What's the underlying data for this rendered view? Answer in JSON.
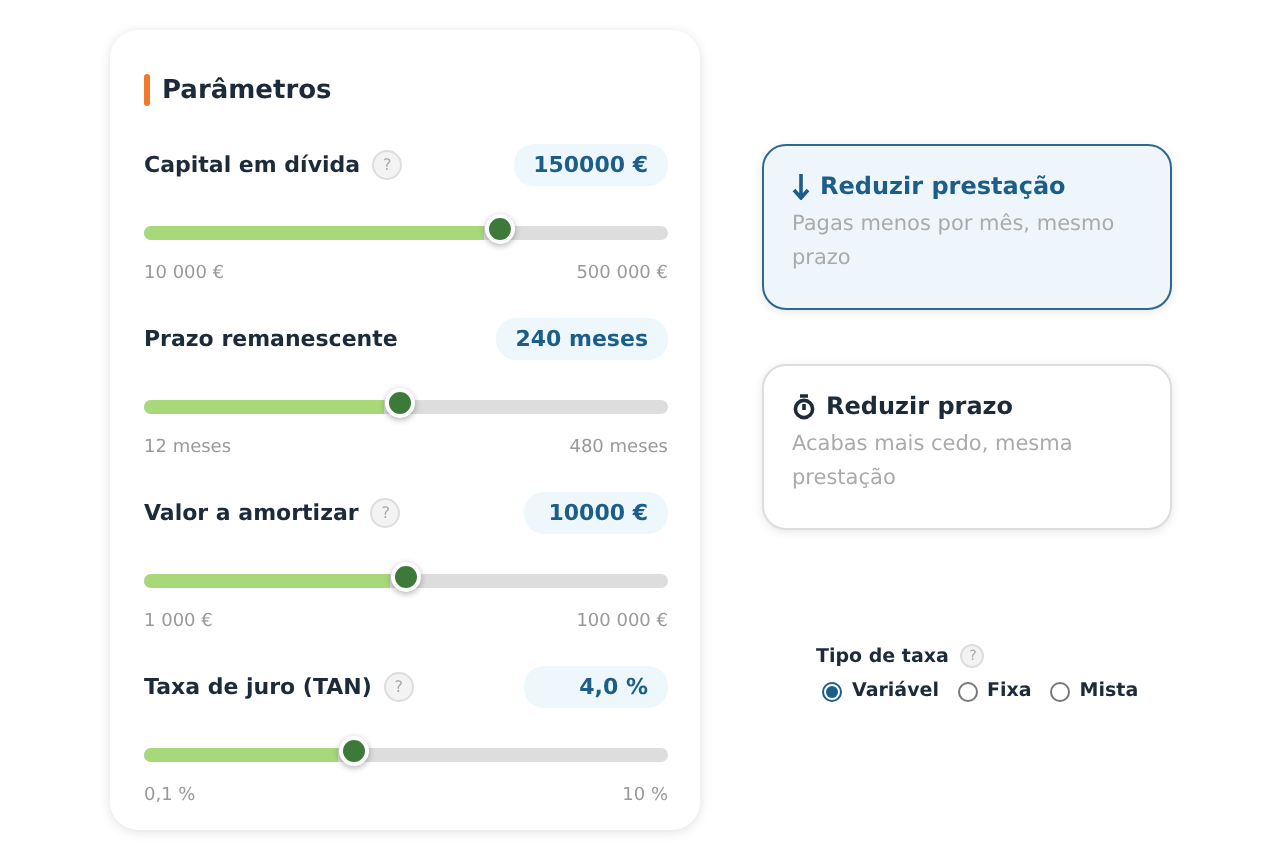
{
  "parameters": {
    "title": "Parâmetros",
    "sliders": [
      {
        "label": "Capital em dívida",
        "help": "?",
        "value": "150000 €",
        "level": 0.68,
        "min": "10 000 €",
        "max": "500 000 €"
      },
      {
        "label": "Prazo remanescente",
        "value": "240 meses",
        "level": 0.49,
        "min": "12 meses",
        "max": "480 meses"
      },
      {
        "label": "Valor a amortizar",
        "help": "?",
        "value": "10000 €",
        "level": 0.5,
        "min": "1 000 €",
        "max": "100 000 €"
      },
      {
        "label": "Taxa de juro (TAN)",
        "help": "?",
        "value": "4,0 %",
        "level": 0.4,
        "min": "0,1 %",
        "max": "10 %"
      }
    ]
  },
  "options": [
    {
      "kind": "arrow",
      "title": "Reduzir prestação",
      "description": "Pagas menos por mês, mesmo prazo",
      "selected": true
    },
    {
      "kind": "timer",
      "title": "Reduzir prazo",
      "description": "Acabas mais cedo, mesma prestação",
      "selected": false
    }
  ],
  "rate_type": {
    "label": "Tipo de taxa",
    "help": "?",
    "choices": [
      {
        "label": "Variável",
        "selected": true
      },
      {
        "label": "Fixa",
        "selected": false
      },
      {
        "label": "Mista",
        "selected": false
      }
    ]
  }
}
